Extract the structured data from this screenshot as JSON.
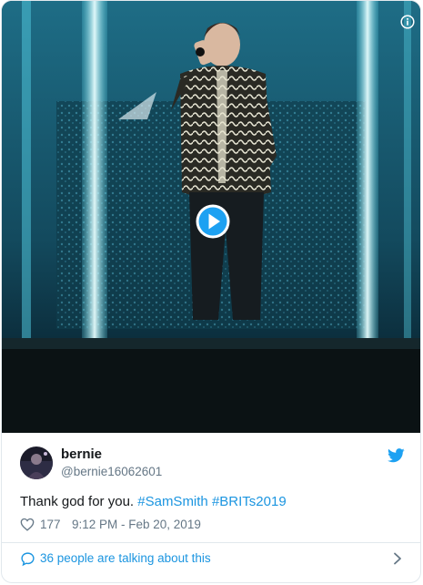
{
  "tweet": {
    "author": {
      "display_name": "bernie",
      "handle": "@bernie16062601",
      "avatar_icon": "avatar-photo"
    },
    "text": {
      "body": "Thank god for you.",
      "hashtags": [
        "#SamSmith",
        "#BRITs2019"
      ]
    },
    "likes": "177",
    "timestamp": "9:12 PM - Feb 20, 2019",
    "footer": {
      "talking_label": "36 people are talking about this"
    }
  },
  "media": {
    "type": "video",
    "play_icon": "play-icon",
    "info_icon": "info-icon"
  },
  "colors": {
    "twitter_blue": "#1da1f2",
    "link_blue": "#1b95e0",
    "muted_gray": "#657786",
    "text_dark": "#14171a",
    "border": "#e1e8ed"
  }
}
